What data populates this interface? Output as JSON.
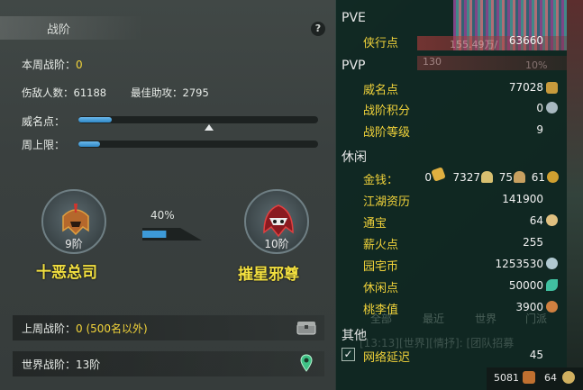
{
  "left": {
    "title": "战阶",
    "help_label": "?",
    "week_rank_label": "本周战阶：",
    "week_rank_value": "0",
    "kills_label": "伤敌人数：",
    "kills_value": "61188",
    "assists_label": "最佳助攻：",
    "assists_value": "2795",
    "prestige_label": "威名点：",
    "prestige_progress": 0.14,
    "weekly_cap_label": "周上限：",
    "weekly_cap_progress": 0.09,
    "current_rank": {
      "level": "9阶",
      "name": "十恶总司"
    },
    "next_rank": {
      "level": "10阶",
      "name": "摧星邪尊"
    },
    "advance_percent": "40%",
    "advance_progress": 0.4,
    "last_week_label": "上周战阶：",
    "last_week_value": "0 (500名以外)",
    "world_rank_label": "世界战阶：",
    "world_rank_value": "13阶"
  },
  "right": {
    "pve_header": "PVE",
    "pvp_header": "PVP",
    "leisure_header": "休闲",
    "other_header": "其他",
    "pve_items": [
      {
        "label": "侠行点",
        "value": "63660"
      }
    ],
    "pvp_items": [
      {
        "label": "威名点",
        "value": "77028"
      },
      {
        "label": "战阶积分",
        "value": "0"
      },
      {
        "label": "战阶等级",
        "value": "9"
      }
    ],
    "money": {
      "label": "金钱：",
      "gold": "0",
      "silver": "7327",
      "copper": "75",
      "coin": "61"
    },
    "leisure_items": [
      {
        "label": "江湖资历",
        "value": "141900"
      },
      {
        "label": "通宝",
        "value": "64"
      },
      {
        "label": "薪火点",
        "value": "255"
      },
      {
        "label": "园宅币",
        "value": "1253530"
      },
      {
        "label": "休闲点",
        "value": "50000"
      },
      {
        "label": "桃李值",
        "value": "3900"
      }
    ],
    "other_items": [
      {
        "label": "网络延迟",
        "value": "45",
        "checked": true
      }
    ],
    "bg_overlay_texts": [
      "155.49万/",
      "130",
      "10%",
      "全部",
      "最近",
      "世界",
      "门派"
    ],
    "bg_chat_text": "[13:13][世界][情抒]: [团队招募",
    "bottom_value_left": "5081",
    "bottom_value_right": "64"
  },
  "colors": {
    "gold_text": "#f0d23a",
    "rank_name": "#f3e040",
    "bar_blue": "#3d9ad8"
  }
}
